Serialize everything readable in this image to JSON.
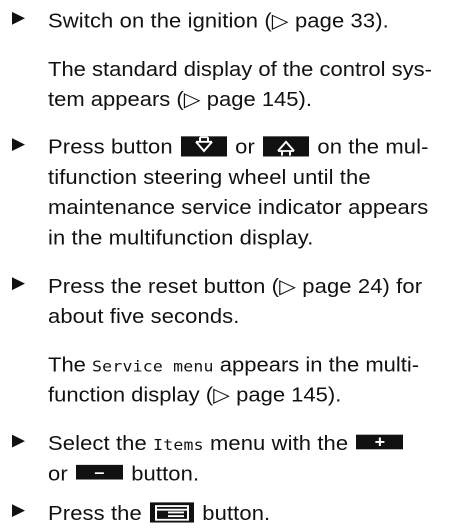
{
  "steps": [
    {
      "text": "Switch on the ignition (▷ page 33)."
    },
    {
      "result_line1": "The standard display of the control sys-",
      "result_line2": "tem appears (▷ page 145)."
    },
    {
      "line1_press": "Press button",
      "line1_or": "or",
      "line1_end": "on the mul-",
      "line2": "tifunction steering wheel until the",
      "line3": "maintenance service indicator appears",
      "line4": "in the multifunction display."
    },
    {
      "line1": "Press the reset button (▷ page 24) for",
      "line2": "about five seconds."
    },
    {
      "result_prefix": "The",
      "result_menu": "Service menu",
      "result_suffix": "appears in the multi-",
      "result_line2": "function display (▷ page 145)."
    },
    {
      "prefix": "Select the",
      "menu": "Items",
      "mid": "menu with the",
      "plus": "+",
      "or": "or",
      "minus": "–",
      "suffix": "button."
    },
    {
      "prefix": "Press the",
      "suffix": "button."
    }
  ],
  "icons": {
    "down": "arrow-down-icon",
    "up": "arrow-up-icon",
    "plus": "plus-icon",
    "minus": "minus-icon",
    "menu": "menu-icon",
    "bullet": "triangle-bullet-icon"
  },
  "colors": {
    "text": "#111111",
    "button_background": "#111111",
    "button_foreground": "#ffffff",
    "page_background": "#ffffff"
  }
}
